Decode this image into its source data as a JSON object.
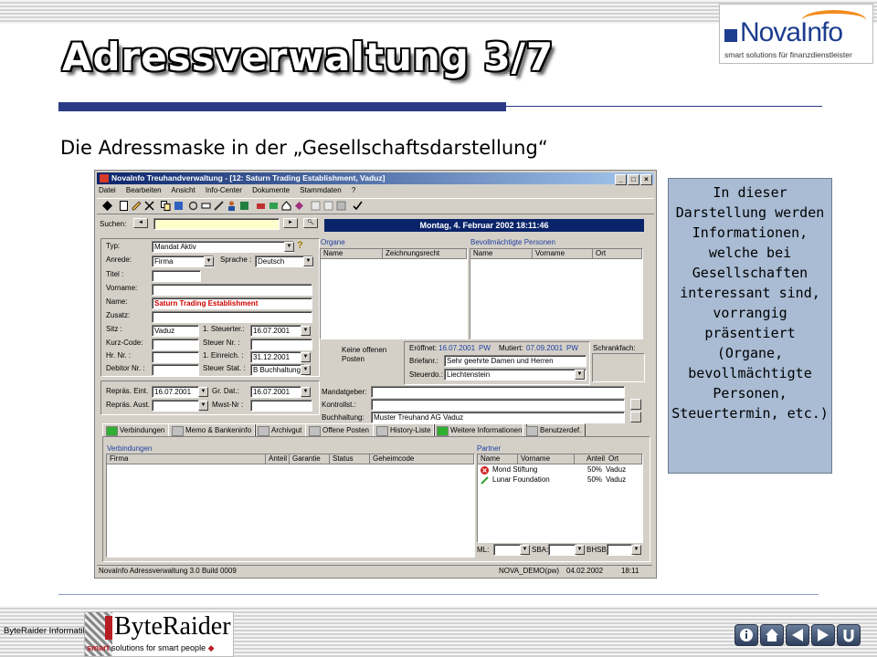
{
  "slide": {
    "title": "Adressverwaltung 3/7",
    "subtitle": "Die Adressmaske in der „Gesellschaftsdarstellung“",
    "side_note": "In dieser Darstellung werden Informationen, welche bei Gesellschaften interessant sind, vorrangig präsentiert (Organe, bevollmächtigte Personen, Steuertermin, etc.)",
    "logo_top": {
      "name": "NovaInfo",
      "tagline": "smart solutions für finanzdienstleister"
    },
    "logo_bottom": {
      "company_text": "ByteRaider Informatik",
      "name": "ByteRaider",
      "tagline_smart": "smart",
      "tagline_rest": " solutions for smart people"
    },
    "colors": {
      "accent": "#2b3a87",
      "note_bg": "#a9bcd4"
    },
    "nav_icons": [
      "info-icon",
      "home-icon",
      "previous-icon",
      "next-icon",
      "return-icon"
    ]
  },
  "app": {
    "window_title": "NovaInfo Treuhandverwaltung - [12: Saturn Trading Establishment, Vaduz]",
    "window_buttons": [
      "_",
      "□",
      "×"
    ],
    "menu": [
      "Datei",
      "Bearbeiten",
      "Ansicht",
      "Info-Center",
      "Dokumente",
      "Stammdaten",
      "?"
    ],
    "search_label": "Suchen:",
    "date_display": "Montag, 4. Februar 2002 18:11:46",
    "form": {
      "typ_label": "Typ:",
      "typ_value": "Mandat Aktiv",
      "anrede_label": "Anrede:",
      "anrede_value": "Firma",
      "sprache_label": "Sprache :",
      "sprache_value": "Deutsch",
      "titel_label": "Titel :",
      "vorname_label": "Vorname:",
      "name_label": "Name:",
      "name_value": "Saturn Trading Establishment",
      "zusatz_label": "Zusatz:",
      "sitz_label": "Sitz :",
      "sitz_value": "Vaduz",
      "steuerter_label": "1. Steuerter.:",
      "steuerter_value": "16.07.2001",
      "kurzcode_label": "Kurz-Code:",
      "steuernr_label": "Steuer Nr. :",
      "hrnr_label": "Hr. Nr. :",
      "einreich_label": "1. Einreich. :",
      "einreich_value": "31.12.2001",
      "debitor_label": "Debitor Nr. :",
      "steuerstat_label": "Steuer Stat. :",
      "steuerstat_value": "B Buchhaltung",
      "repras_eint_label": "Repräs. Eint.",
      "repras_eint_value": "16.07.2001",
      "grdat_label": "Gr. Dat.:",
      "grdat_value": "16.07.2001",
      "repras_aust_label": "Repräs. Aust.",
      "mwst_label": "Mwst-Nr :"
    },
    "organe": {
      "title": "Organe",
      "columns": [
        "Name",
        "Zeichnungsrecht"
      ]
    },
    "bevollmaechtigte": {
      "title": "Bevollmächtigte Personen",
      "columns": [
        "Name",
        "Vorname",
        "Ort"
      ]
    },
    "posten": {
      "text": "Keine offenen Posten"
    },
    "info": {
      "eroeffnet_label": "Eröffnet:",
      "eroeffnet_value": "16.07.2001",
      "eroeffnet_user": "PW",
      "mutiert_label": "Mutiert:",
      "mutiert_value": "07.09.2001",
      "mutiert_user": "PW",
      "briefanr_label": "Briefanr.:",
      "briefanr_value": "Sehr geehrte Damen und Herren",
      "steuerdo_label": "Steuerdo.:",
      "steuerdo_value": "Liechtenstein",
      "schrankfach_label": "Schrankfach:"
    },
    "mandat": {
      "mandatgeber_label": "Mandatgeber:",
      "kontrollst_label": "Kontrollst.:",
      "buchhaltung_label": "Buchhaltung:",
      "buchhaltung_value": "Muster Treuhand AG  Vaduz"
    },
    "tabs": [
      "Verbindungen",
      "Memo & Bankeninfo",
      "Archivgut",
      "Offene Posten",
      "History-Liste",
      "Weitere Informationen",
      "Benutzerdef."
    ],
    "verbindungen": {
      "title": "Verbindungen",
      "columns": [
        "Firma",
        "Anteil",
        "Garantie",
        "Status",
        "Geheimcode"
      ]
    },
    "partner": {
      "title": "Partner",
      "columns": [
        "Name",
        "Vorname",
        "Anteil",
        "Ort"
      ],
      "rows": [
        {
          "name": "Mond Stiftung",
          "anteil": "50%",
          "ort": "Vaduz",
          "icon": "delete-icon"
        },
        {
          "name": "Lunar Foundation",
          "anteil": "50%",
          "ort": "Vaduz",
          "icon": "pen-icon"
        }
      ],
      "footer": [
        "ML:",
        "SBA:",
        "BHSB:"
      ]
    },
    "status": {
      "left": "NovaInfo Adressverwaltung 3.0 Build 0009",
      "user": "NOVA_DEMO(pw)",
      "date": "04.02.2002",
      "time": "18:11"
    }
  }
}
